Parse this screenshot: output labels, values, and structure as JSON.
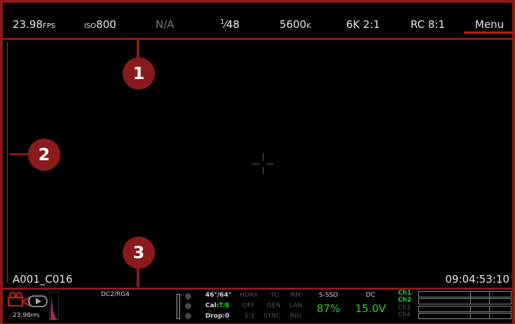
{
  "topbar": {
    "fps_value": "23.98",
    "fps_unit": "FPS",
    "iso_prefix": "ISO",
    "iso_value": "800",
    "aperture": "N/A",
    "shutter_numerator": "1",
    "shutter_denominator": "48",
    "white_balance_value": "5600",
    "white_balance_unit": "K",
    "resolution": "6K",
    "resolution_ratio": "2:1",
    "compression": "RC 8:1",
    "menu_label": "Menu"
  },
  "callouts": {
    "one": "1",
    "two": "2",
    "three": "3"
  },
  "viewport": {
    "clip_name": "A001_C016",
    "timecode": "09:04:53:10"
  },
  "bottombar": {
    "fps_value": "23.98",
    "fps_unit": "FPS",
    "look": "DC2/RG4",
    "temp": "46°/64°",
    "cal_prefix": "Cal:",
    "cal_value": "T/E",
    "drop": "Drop:0",
    "hdrx": "HDRX",
    "hdrx_value": "OFF",
    "aspect": "1:1",
    "tc": "TC",
    "tc_value": "GEN",
    "sync": "SYNC",
    "rm": "RM",
    "rm_value": "LAN",
    "rig": "RIG",
    "media_label": "S-SSD",
    "media_value": "87%",
    "power_label": "DC",
    "power_value": "15.0V",
    "channels": [
      "Ch1",
      "Ch2",
      "Ch3",
      "Ch4"
    ],
    "colors": {
      "accent": "#8b1a1a",
      "green": "#2dd12d",
      "red_icon": "#c41e1e"
    }
  }
}
